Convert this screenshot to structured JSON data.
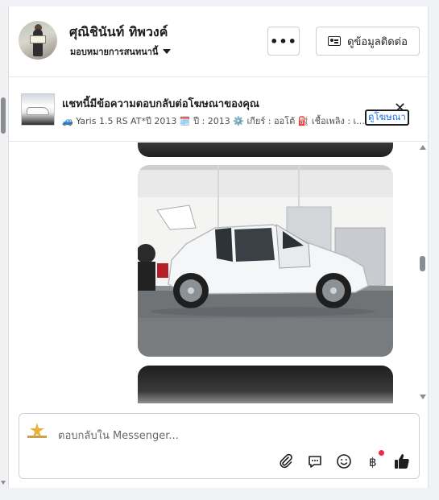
{
  "header": {
    "name": "ศุณิชินันท์ ทิพวงค์",
    "assign_label": "มอบหมายการสนทนานี้",
    "more_label": "•••",
    "contact_label": "ดูข้อมูลติดต่อ"
  },
  "ad": {
    "title": "แชทนี้มีข้อความตอบกลับต่อโฆษณาของคุณ",
    "subtitle": "🚙 Yaris 1.5 RS AT*ปี 2013 🗓️ ปี : 2013 ⚙️ เกียร์ : ออโต้ ⛽ เชื้อเพลิง : เ...",
    "view_ad_label": "ดูโฆษณา",
    "close_label": "✕"
  },
  "composer": {
    "placeholder": "ตอบกลับใน Messenger..."
  },
  "icons": {
    "avatar": "profile-photo",
    "dropdown": "chevron-down-icon",
    "more": "more-icon",
    "contact": "id-card-icon",
    "attach": "paperclip-icon",
    "saved_reply": "chat-bubble-icon",
    "emoji": "emoji-icon",
    "payment": "baht-icon",
    "like": "thumbs-up-icon"
  },
  "colors": {
    "link": "#1a73e8",
    "like": "#1c1e21",
    "badge": "#f02849"
  }
}
